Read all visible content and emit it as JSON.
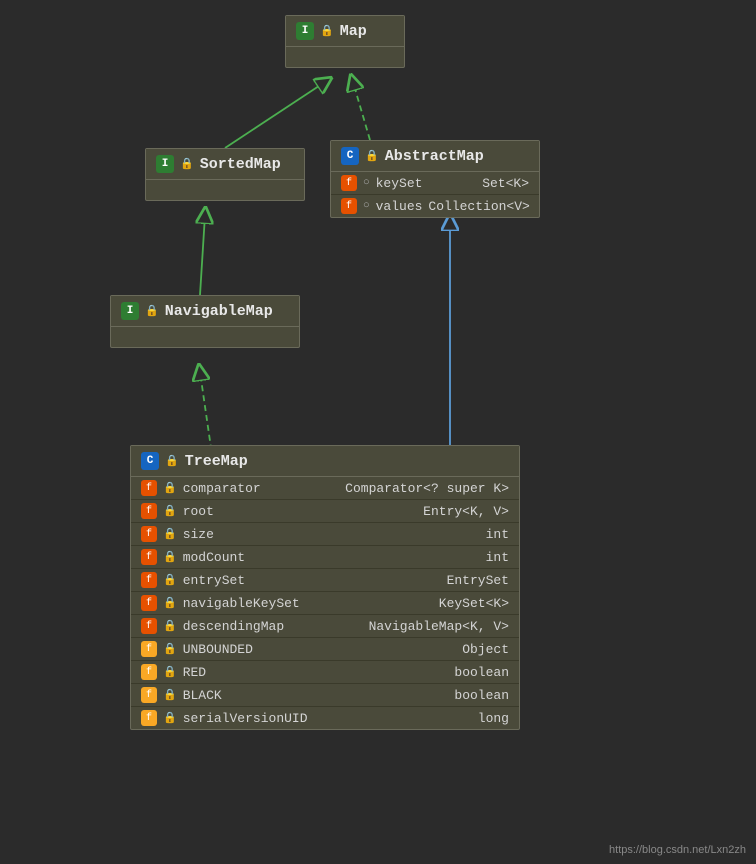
{
  "map": {
    "name": "Map",
    "badge": "I",
    "badge_type": "interface"
  },
  "sortedmap": {
    "name": "SortedMap",
    "badge": "I",
    "badge_type": "interface"
  },
  "abstractmap": {
    "name": "AbstractMap",
    "badge": "C",
    "badge_type": "class",
    "fields": [
      {
        "icon": "f",
        "lock": "o",
        "name": "keySet",
        "type": "Set<K>"
      },
      {
        "icon": "f",
        "lock": "o",
        "name": "values",
        "type": "Collection<V>"
      }
    ]
  },
  "navigablemap": {
    "name": "NavigableMap",
    "badge": "I",
    "badge_type": "interface"
  },
  "treemap": {
    "name": "TreeMap",
    "badge": "C",
    "badge_type": "class",
    "fields": [
      {
        "icon": "f",
        "lock": "red",
        "name": "comparator",
        "type": "Comparator<? super K>"
      },
      {
        "icon": "f",
        "lock": "red",
        "name": "root",
        "type": "Entry<K, V>"
      },
      {
        "icon": "f",
        "lock": "red",
        "name": "size",
        "type": "int"
      },
      {
        "icon": "f",
        "lock": "red",
        "name": "modCount",
        "type": "int"
      },
      {
        "icon": "f",
        "lock": "red",
        "name": "entrySet",
        "type": "EntrySet"
      },
      {
        "icon": "f",
        "lock": "red",
        "name": "navigableKeySet",
        "type": "KeySet<K>"
      },
      {
        "icon": "f",
        "lock": "red",
        "name": "descendingMap",
        "type": "NavigableMap<K, V>"
      },
      {
        "icon": "f",
        "lock": "red",
        "name": "UNBOUNDED",
        "type": "Object"
      },
      {
        "icon": "f",
        "lock": "red",
        "name": "RED",
        "type": "boolean"
      },
      {
        "icon": "f",
        "lock": "red",
        "name": "BLACK",
        "type": "boolean"
      },
      {
        "icon": "f",
        "lock": "red",
        "name": "serialVersionUID",
        "type": "long"
      }
    ]
  },
  "watermark": "https://blog.csdn.net/Lxn2zh"
}
